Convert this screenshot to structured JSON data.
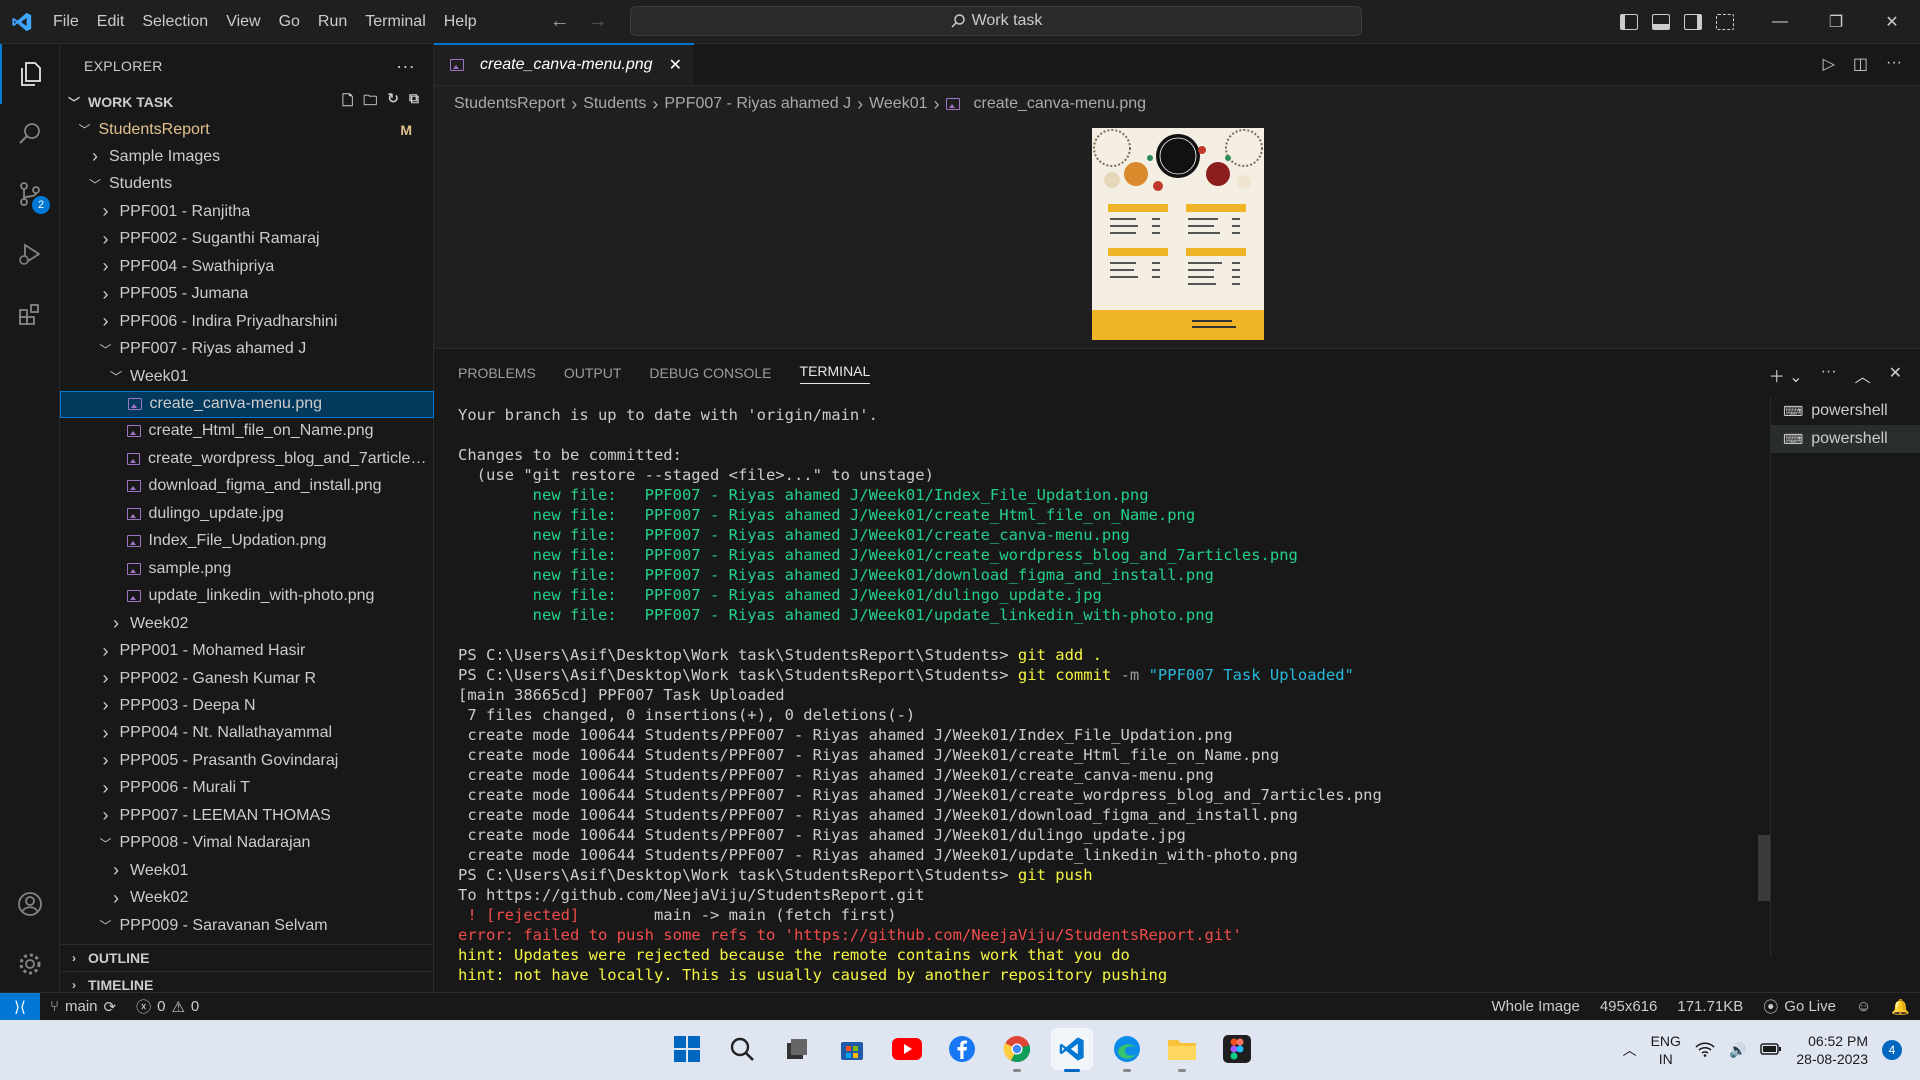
{
  "titlebar": {
    "menu": [
      "File",
      "Edit",
      "Selection",
      "View",
      "Go",
      "Run",
      "Terminal",
      "Help"
    ],
    "search_text": "Work task"
  },
  "activitybar": {
    "scm_badge": "2"
  },
  "sidebar": {
    "title": "EXPLORER",
    "section": "WORK TASK",
    "outline": "OUTLINE",
    "timeline": "TIMELINE",
    "tree": [
      {
        "label": "StudentsReport",
        "indent": 1,
        "chev": "open",
        "status": "M",
        "highlight": true
      },
      {
        "label": "Sample Images",
        "indent": 2,
        "chev": "closed"
      },
      {
        "label": "Students",
        "indent": 2,
        "chev": "open"
      },
      {
        "label": "PPF001 - Ranjitha",
        "indent": 3,
        "chev": "closed"
      },
      {
        "label": "PPF002 - Suganthi Ramaraj",
        "indent": 3,
        "chev": "closed"
      },
      {
        "label": "PPF004 - Swathipriya",
        "indent": 3,
        "chev": "closed"
      },
      {
        "label": "PPF005 - Jumana",
        "indent": 3,
        "chev": "closed"
      },
      {
        "label": "PPF006 - Indira Priyadharshini",
        "indent": 3,
        "chev": "closed"
      },
      {
        "label": "PPF007 - Riyas ahamed J",
        "indent": 3,
        "chev": "open"
      },
      {
        "label": "Week01",
        "indent": 4,
        "chev": "open"
      },
      {
        "label": "create_canva-menu.png",
        "indent": 5,
        "file": true,
        "selected": true
      },
      {
        "label": "create_Html_file_on_Name.png",
        "indent": 5,
        "file": true
      },
      {
        "label": "create_wordpress_blog_and_7articles.p...",
        "indent": 5,
        "file": true
      },
      {
        "label": "download_figma_and_install.png",
        "indent": 5,
        "file": true
      },
      {
        "label": "dulingo_update.jpg",
        "indent": 5,
        "file": true
      },
      {
        "label": "Index_File_Updation.png",
        "indent": 5,
        "file": true
      },
      {
        "label": "sample.png",
        "indent": 5,
        "file": true
      },
      {
        "label": "update_linkedin_with-photo.png",
        "indent": 5,
        "file": true
      },
      {
        "label": "Week02",
        "indent": 4,
        "chev": "closed"
      },
      {
        "label": "PPP001 - Mohamed Hasir",
        "indent": 3,
        "chev": "closed"
      },
      {
        "label": "PPP002 - Ganesh Kumar R",
        "indent": 3,
        "chev": "closed"
      },
      {
        "label": "PPP003 - Deepa N",
        "indent": 3,
        "chev": "closed"
      },
      {
        "label": "PPP004 - Nt. Nallathayammal",
        "indent": 3,
        "chev": "closed"
      },
      {
        "label": "PPP005 - Prasanth Govindaraj",
        "indent": 3,
        "chev": "closed"
      },
      {
        "label": "PPP006 - Murali T",
        "indent": 3,
        "chev": "closed"
      },
      {
        "label": "PPP007 - LEEMAN THOMAS",
        "indent": 3,
        "chev": "closed"
      },
      {
        "label": "PPP008 - Vimal Nadarajan",
        "indent": 3,
        "chev": "open"
      },
      {
        "label": "Week01",
        "indent": 4,
        "chev": "closed"
      },
      {
        "label": "Week02",
        "indent": 4,
        "chev": "closed"
      },
      {
        "label": "PPP009 - Saravanan Selvam",
        "indent": 3,
        "chev": "open"
      }
    ]
  },
  "editor": {
    "tab_label": "create_canva-menu.png",
    "breadcrumbs": [
      "StudentsReport",
      "Students",
      "PPF007 - Riyas ahamed J",
      "Week01",
      "create_canva-menu.png"
    ]
  },
  "preview": {
    "brand": "SOUTH INDIAN",
    "sub": "RESTAURANT",
    "sections": [
      "Dosa",
      "Briyani",
      "Appetizers",
      "Dessert"
    ]
  },
  "panel": {
    "tabs": [
      "PROBLEMS",
      "OUTPUT",
      "DEBUG CONSOLE",
      "TERMINAL"
    ],
    "terminals": [
      "powershell",
      "powershell"
    ],
    "lines": [
      [
        {
          "t": "Your branch is up to date with 'origin/main'."
        }
      ],
      [
        {
          "t": ""
        }
      ],
      [
        {
          "t": "Changes to be committed:"
        }
      ],
      [
        {
          "t": "  (use \"git restore --staged <file>...\" to unstage)"
        }
      ],
      [
        {
          "t": "        new file:   PPF007 - Riyas ahamed J/Week01/Index_File_Updation.png",
          "c": "green"
        }
      ],
      [
        {
          "t": "        new file:   PPF007 - Riyas ahamed J/Week01/create_Html_file_on_Name.png",
          "c": "green"
        }
      ],
      [
        {
          "t": "        new file:   PPF007 - Riyas ahamed J/Week01/create_canva-menu.png",
          "c": "green"
        }
      ],
      [
        {
          "t": "        new file:   PPF007 - Riyas ahamed J/Week01/create_wordpress_blog_and_7articles.png",
          "c": "green"
        }
      ],
      [
        {
          "t": "        new file:   PPF007 - Riyas ahamed J/Week01/download_figma_and_install.png",
          "c": "green"
        }
      ],
      [
        {
          "t": "        new file:   PPF007 - Riyas ahamed J/Week01/dulingo_update.jpg",
          "c": "green"
        }
      ],
      [
        {
          "t": "        new file:   PPF007 - Riyas ahamed J/Week01/update_linkedin_with-photo.png",
          "c": "green"
        }
      ],
      [
        {
          "t": ""
        }
      ],
      [
        {
          "t": "PS C:\\Users\\Asif\\Desktop\\Work task\\StudentsReport\\Students> "
        },
        {
          "t": "git add .",
          "c": "yellow"
        }
      ],
      [
        {
          "t": "PS C:\\Users\\Asif\\Desktop\\Work task\\StudentsReport\\Students> "
        },
        {
          "t": "git commit ",
          "c": "yellow"
        },
        {
          "t": "-m ",
          "c": "gray"
        },
        {
          "t": "\"PPF007 Task Uploaded\"",
          "c": "blue"
        }
      ],
      [
        {
          "t": "[main 38665cd] PPF007 Task Uploaded"
        }
      ],
      [
        {
          "t": " 7 files changed, 0 insertions(+), 0 deletions(-)"
        }
      ],
      [
        {
          "t": " create mode 100644 Students/PPF007 - Riyas ahamed J/Week01/Index_File_Updation.png"
        }
      ],
      [
        {
          "t": " create mode 100644 Students/PPF007 - Riyas ahamed J/Week01/create_Html_file_on_Name.png"
        }
      ],
      [
        {
          "t": " create mode 100644 Students/PPF007 - Riyas ahamed J/Week01/create_canva-menu.png"
        }
      ],
      [
        {
          "t": " create mode 100644 Students/PPF007 - Riyas ahamed J/Week01/create_wordpress_blog_and_7articles.png"
        }
      ],
      [
        {
          "t": " create mode 100644 Students/PPF007 - Riyas ahamed J/Week01/download_figma_and_install.png"
        }
      ],
      [
        {
          "t": " create mode 100644 Students/PPF007 - Riyas ahamed J/Week01/dulingo_update.jpg"
        }
      ],
      [
        {
          "t": " create mode 100644 Students/PPF007 - Riyas ahamed J/Week01/update_linkedin_with-photo.png"
        }
      ],
      [
        {
          "t": "PS C:\\Users\\Asif\\Desktop\\Work task\\StudentsReport\\Students> "
        },
        {
          "t": "git push",
          "c": "yellow"
        }
      ],
      [
        {
          "t": "To https://github.com/NeejaViju/StudentsReport.git"
        }
      ],
      [
        {
          "t": " ! [rejected]        ",
          "c": "red"
        },
        {
          "t": "main -> main (fetch first)"
        }
      ],
      [
        {
          "t": "error: failed to push some refs to 'https://github.com/NeejaViju/StudentsReport.git'",
          "c": "red"
        }
      ],
      [
        {
          "t": "hint: Updates were rejected because the remote contains work that you do",
          "c": "yellow"
        }
      ],
      [
        {
          "t": "hint: not have locally. This is usually caused by another repository pushing",
          "c": "yellow"
        }
      ]
    ]
  },
  "statusbar": {
    "branch": "main",
    "errors": "0",
    "warnings": "0",
    "right": [
      "Whole Image",
      "495x616",
      "171.71KB",
      "Go Live"
    ]
  },
  "taskbar": {
    "lang1": "ENG",
    "lang2": "IN",
    "time": "06:52 PM",
    "date": "28-08-2023",
    "notifications": "4"
  }
}
